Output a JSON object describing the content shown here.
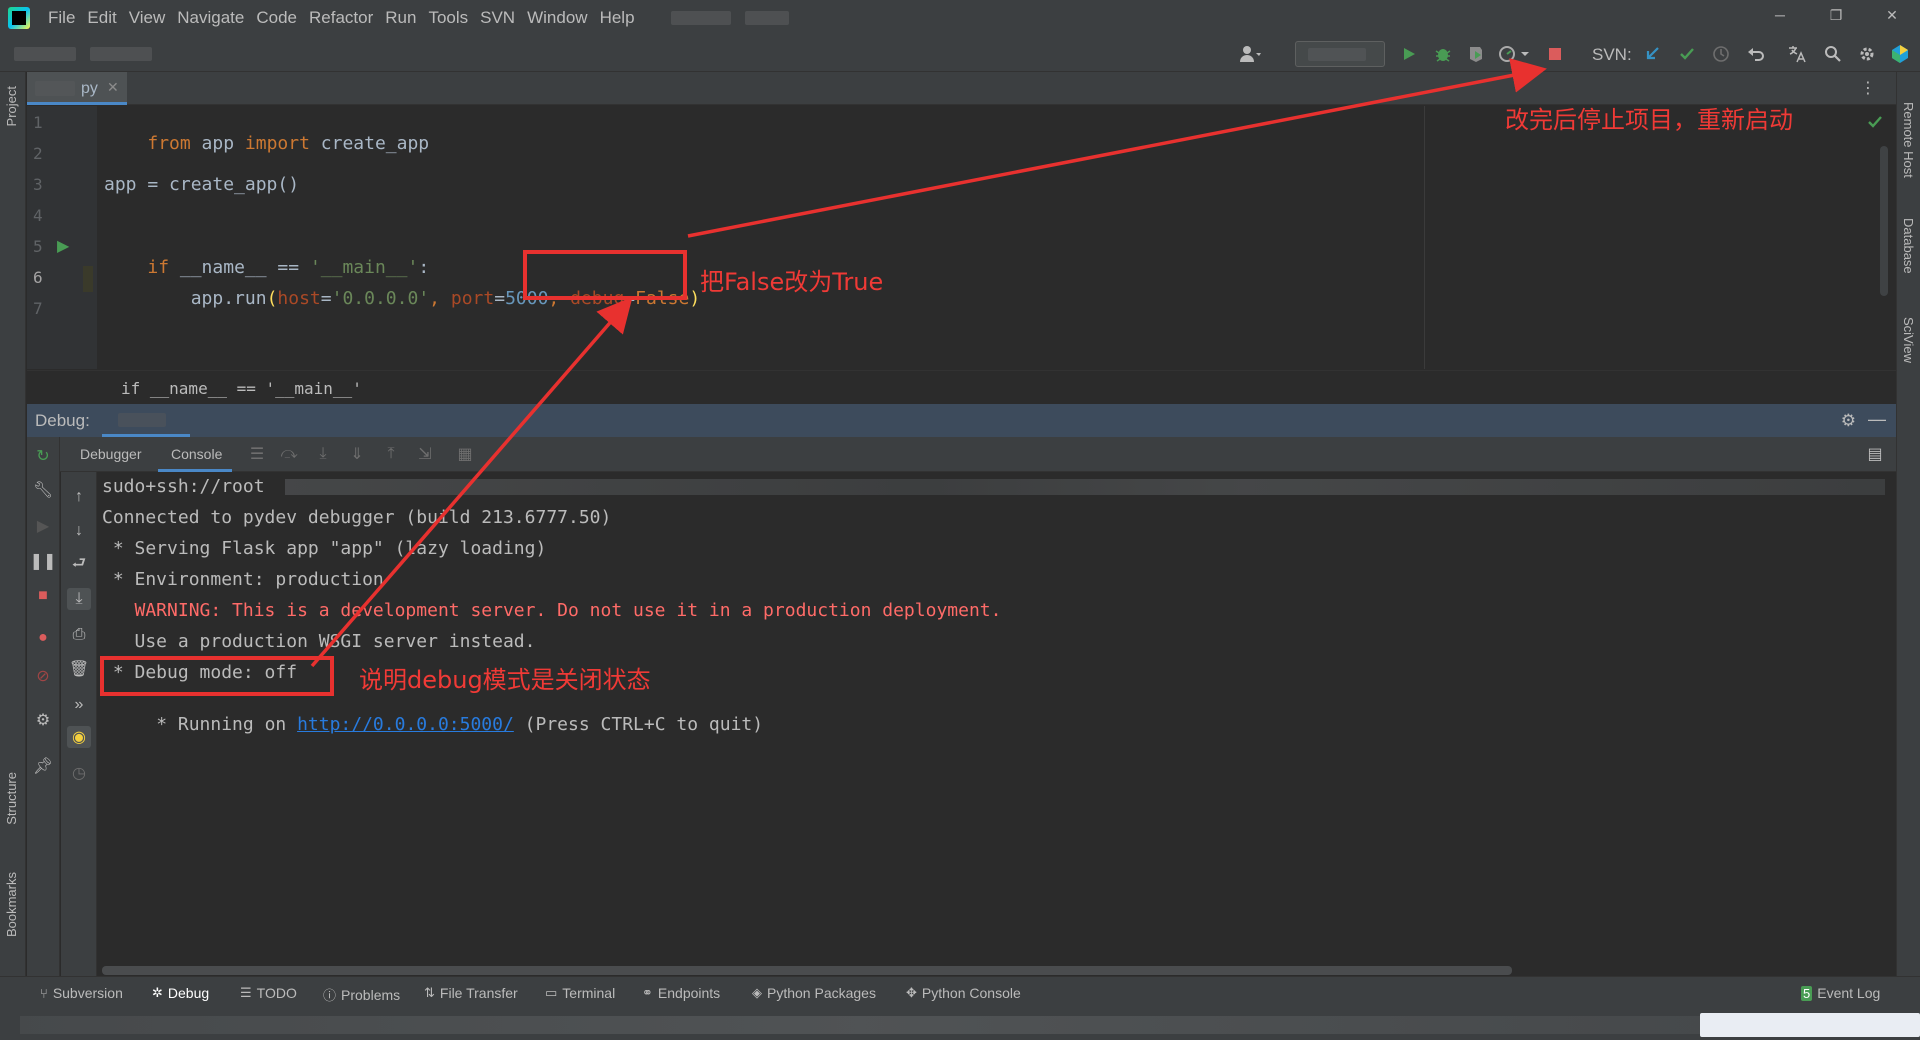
{
  "menubar": {
    "items": [
      "File",
      "Edit",
      "View",
      "Navigate",
      "Code",
      "Refactor",
      "Run",
      "Tools",
      "SVN",
      "Window",
      "Help"
    ],
    "window_controls": [
      "─",
      "❐",
      "✕"
    ]
  },
  "toolbar": {
    "svn_label": "SVN:",
    "icons": [
      "user-icon",
      "run-icon",
      "debug-icon",
      "coverage-icon",
      "profile-icon",
      "stop-icon",
      "svn-update-icon",
      "svn-commit-icon",
      "history-icon",
      "revert-icon",
      "translate-icon",
      "search-icon",
      "settings-icon",
      "toolbox-icon"
    ]
  },
  "left_strip": {
    "project_label": "Project",
    "structure_label": "Structure",
    "bookmarks_label": "Bookmarks"
  },
  "right_strip": {
    "remote_host_label": "Remote Host",
    "database_label": "Database",
    "sciview_label": "SciView"
  },
  "editor": {
    "tab": {
      "label": "py",
      "close": "✕"
    },
    "line_numbers": [
      "1",
      "2",
      "3",
      "4",
      "5",
      "6",
      "7"
    ],
    "lines": {
      "l1": {
        "kw1": "from",
        "t1": " app ",
        "kw2": "import",
        "t2": " create_app"
      },
      "l3": {
        "t": "app = create_app()"
      },
      "l5": {
        "kw": "if",
        "t1": " __name__ == ",
        "s": "'__main__'",
        "t2": ":"
      },
      "l6": {
        "indent": "    app.run",
        "p1": "(",
        "host_k": "host",
        "eq1": "=",
        "host_v": "'0.0.0.0'",
        "c1": ", ",
        "port_k": "port",
        "eq2": "=",
        "port_v": "5000",
        "c2": ", ",
        "debug_k": "debug",
        "eq3": "=",
        "debug_v": "False",
        "p2": ")"
      }
    },
    "breadcrumb": "if __name__ == '__main__'"
  },
  "debug": {
    "title": "Debug:",
    "tabs": {
      "debugger": "Debugger",
      "console": "Console"
    },
    "console_lines": {
      "ssh": "sudo+ssh://root",
      "connected": "Connected to pydev debugger (build 213.6777.50)",
      "serving": " * Serving Flask app \"app\" (lazy loading)",
      "env": " * Environment: production",
      "warning": "   WARNING: This is a development server. Do not use it in a production deployment.",
      "use_wsgi": "   Use a production WSGI server instead.",
      "debug_mode": " * Debug mode: off",
      "running_prefix": " * Running on ",
      "running_url": "http://0.0.0.0:5000/",
      "running_suffix": " (Press CTRL+C to quit)"
    }
  },
  "bottom_tools": {
    "subversion": "Subversion",
    "debug": "Debug",
    "todo": "TODO",
    "problems": "Problems",
    "file_transfer": "File Transfer",
    "terminal": "Terminal",
    "endpoints": "Endpoints",
    "python_packages": "Python Packages",
    "python_console": "Python Console",
    "event_log": "Event Log"
  },
  "annotations": {
    "restart": "改完后停止项目，重新启动",
    "change_false": "把False改为True",
    "debug_off": "说明debug模式是关闭状态"
  },
  "colors": {
    "annotation_red": "#e8312f",
    "keyword": "#cc7832",
    "string": "#6a8759",
    "number": "#6897bb",
    "param": "#aa4926",
    "warning": "#ff6b68",
    "link": "#287bde"
  }
}
